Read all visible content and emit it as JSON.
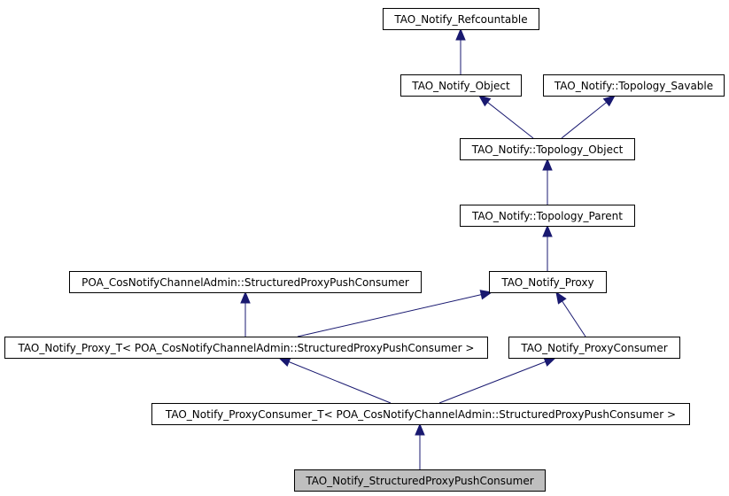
{
  "diagram": {
    "type": "class-inheritance-graph",
    "colors": {
      "edge": "#191970",
      "node_fill": "#ffffff",
      "highlight_fill": "#bfbfbf",
      "border": "#000000"
    },
    "nodes": [
      {
        "id": "refcountable",
        "label": "TAO_Notify_Refcountable",
        "highlighted": false
      },
      {
        "id": "object",
        "label": "TAO_Notify_Object",
        "highlighted": false
      },
      {
        "id": "topology_savable",
        "label": "TAO_Notify::Topology_Savable",
        "highlighted": false
      },
      {
        "id": "topology_object",
        "label": "TAO_Notify::Topology_Object",
        "highlighted": false
      },
      {
        "id": "topology_parent",
        "label": "TAO_Notify::Topology_Parent",
        "highlighted": false
      },
      {
        "id": "poa_structured",
        "label": "POA_CosNotifyChannelAdmin::StructuredProxyPushConsumer",
        "highlighted": false
      },
      {
        "id": "proxy",
        "label": "TAO_Notify_Proxy",
        "highlighted": false
      },
      {
        "id": "proxy_t",
        "label": "TAO_Notify_Proxy_T< POA_CosNotifyChannelAdmin::StructuredProxyPushConsumer >",
        "highlighted": false
      },
      {
        "id": "proxy_consumer",
        "label": "TAO_Notify_ProxyConsumer",
        "highlighted": false
      },
      {
        "id": "proxy_consumer_t",
        "label": "TAO_Notify_ProxyConsumer_T< POA_CosNotifyChannelAdmin::StructuredProxyPushConsumer >",
        "highlighted": false
      },
      {
        "id": "structured_ppc",
        "label": "TAO_Notify_StructuredProxyPushConsumer",
        "highlighted": true
      }
    ],
    "edges": [
      {
        "from": "object",
        "to": "refcountable"
      },
      {
        "from": "topology_object",
        "to": "object"
      },
      {
        "from": "topology_object",
        "to": "topology_savable"
      },
      {
        "from": "topology_parent",
        "to": "topology_object"
      },
      {
        "from": "proxy",
        "to": "topology_parent"
      },
      {
        "from": "proxy_t",
        "to": "poa_structured"
      },
      {
        "from": "proxy_t",
        "to": "proxy"
      },
      {
        "from": "proxy_consumer",
        "to": "proxy"
      },
      {
        "from": "proxy_consumer_t",
        "to": "proxy_t"
      },
      {
        "from": "proxy_consumer_t",
        "to": "proxy_consumer"
      },
      {
        "from": "structured_ppc",
        "to": "proxy_consumer_t"
      }
    ]
  }
}
